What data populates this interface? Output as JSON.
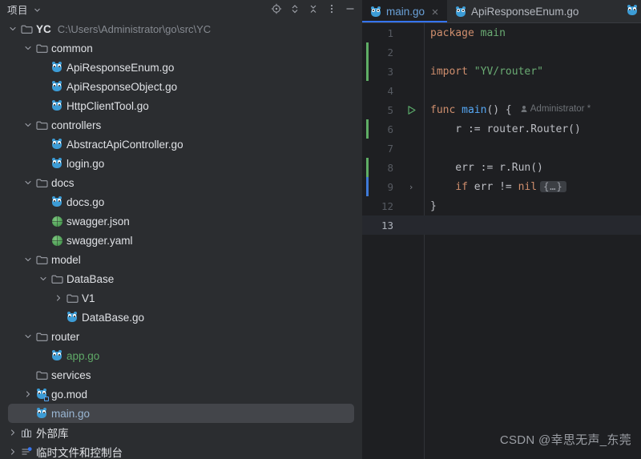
{
  "window": {
    "theme_bg": "#1E1F22",
    "sidebar_bg": "#2B2D30",
    "accent": "#3574F0"
  },
  "sidebar": {
    "title": "项目",
    "title_chevron_icon": "chevron-down-icon",
    "tools": [
      {
        "name": "locate-file-icon",
        "tooltip": "Select Opened File"
      },
      {
        "name": "expand-all-icon",
        "tooltip": "Expand All"
      },
      {
        "name": "collapse-all-icon",
        "tooltip": "Collapse All"
      },
      {
        "name": "more-options-icon",
        "tooltip": "Options"
      },
      {
        "name": "hide-panel-icon",
        "tooltip": "Hide"
      }
    ],
    "tree": [
      {
        "label": "YC",
        "sublabel": "C:\\Users\\Administrator\\go\\src\\YC",
        "indent": 0,
        "twisty": "expanded",
        "icon": "folder-icon",
        "bold": true,
        "state": "normal"
      },
      {
        "label": "common",
        "sublabel": "",
        "indent": 1,
        "twisty": "expanded",
        "icon": "folder-icon",
        "bold": false,
        "state": "normal"
      },
      {
        "label": "ApiResponseEnum.go",
        "sublabel": "",
        "indent": 2,
        "twisty": "none",
        "icon": "go-file-icon",
        "bold": false,
        "state": "normal"
      },
      {
        "label": "ApiResponseObject.go",
        "sublabel": "",
        "indent": 2,
        "twisty": "none",
        "icon": "go-file-icon",
        "bold": false,
        "state": "normal"
      },
      {
        "label": "HttpClientTool.go",
        "sublabel": "",
        "indent": 2,
        "twisty": "none",
        "icon": "go-file-icon",
        "bold": false,
        "state": "normal"
      },
      {
        "label": "controllers",
        "sublabel": "",
        "indent": 1,
        "twisty": "expanded",
        "icon": "folder-icon",
        "bold": false,
        "state": "normal"
      },
      {
        "label": "AbstractApiController.go",
        "sublabel": "",
        "indent": 2,
        "twisty": "none",
        "icon": "go-file-icon",
        "bold": false,
        "state": "normal"
      },
      {
        "label": "login.go",
        "sublabel": "",
        "indent": 2,
        "twisty": "none",
        "icon": "go-file-icon",
        "bold": false,
        "state": "normal"
      },
      {
        "label": "docs",
        "sublabel": "",
        "indent": 1,
        "twisty": "expanded",
        "icon": "folder-icon",
        "bold": false,
        "state": "normal"
      },
      {
        "label": "docs.go",
        "sublabel": "",
        "indent": 2,
        "twisty": "none",
        "icon": "go-file-icon",
        "bold": false,
        "state": "normal"
      },
      {
        "label": "swagger.json",
        "sublabel": "",
        "indent": 2,
        "twisty": "none",
        "icon": "json-file-icon",
        "bold": false,
        "state": "normal"
      },
      {
        "label": "swagger.yaml",
        "sublabel": "",
        "indent": 2,
        "twisty": "none",
        "icon": "yaml-file-icon",
        "bold": false,
        "state": "normal"
      },
      {
        "label": "model",
        "sublabel": "",
        "indent": 1,
        "twisty": "expanded",
        "icon": "folder-icon",
        "bold": false,
        "state": "normal"
      },
      {
        "label": "DataBase",
        "sublabel": "",
        "indent": 2,
        "twisty": "expanded",
        "icon": "folder-icon",
        "bold": false,
        "state": "normal"
      },
      {
        "label": "V1",
        "sublabel": "",
        "indent": 3,
        "twisty": "collapsed",
        "icon": "folder-icon",
        "bold": false,
        "state": "normal"
      },
      {
        "label": "DataBase.go",
        "sublabel": "",
        "indent": 3,
        "twisty": "none",
        "icon": "go-file-icon",
        "bold": false,
        "state": "normal"
      },
      {
        "label": "router",
        "sublabel": "",
        "indent": 1,
        "twisty": "expanded",
        "icon": "folder-icon",
        "bold": false,
        "state": "normal"
      },
      {
        "label": "app.go",
        "sublabel": "",
        "indent": 2,
        "twisty": "none",
        "icon": "go-file-icon",
        "bold": false,
        "state": "vcs-added"
      },
      {
        "label": "services",
        "sublabel": "",
        "indent": 1,
        "twisty": "none",
        "icon": "folder-icon",
        "bold": false,
        "state": "normal"
      },
      {
        "label": "go.mod",
        "sublabel": "",
        "indent": 1,
        "twisty": "collapsed",
        "icon": "go-module-icon",
        "bold": false,
        "state": "normal"
      },
      {
        "label": "main.go",
        "sublabel": "",
        "indent": 1,
        "twisty": "none",
        "icon": "go-file-icon",
        "bold": false,
        "state": "selected"
      },
      {
        "label": "外部库",
        "sublabel": "",
        "indent": 0,
        "twisty": "collapsed",
        "icon": "external-libraries-icon",
        "bold": false,
        "state": "normal"
      },
      {
        "label": "临时文件和控制台",
        "sublabel": "",
        "indent": 0,
        "twisty": "collapsed",
        "icon": "scratches-icon",
        "bold": false,
        "state": "normal"
      }
    ]
  },
  "editor": {
    "tabs": [
      {
        "label": "main.go",
        "icon": "go-file-icon",
        "active": true,
        "closable": true
      },
      {
        "label": "ApiResponseEnum.go",
        "icon": "go-file-icon",
        "active": false,
        "closable": false
      }
    ],
    "overflow_tab_icon": "go-file-icon",
    "inlay_hint": "Administrator *",
    "inlay_icon": "author-icon",
    "run_gutter_icon": "run-arrow-icon",
    "fold_placeholder": "{…}",
    "lines": [
      {
        "num": "1",
        "vcs": "none",
        "run": false,
        "fold": false,
        "current": false,
        "tokens": [
          {
            "t": "package",
            "c": "kw"
          },
          {
            "t": " ",
            "c": "plain"
          },
          {
            "t": "main",
            "c": "pkg"
          }
        ]
      },
      {
        "num": "2",
        "vcs": "added",
        "run": false,
        "fold": false,
        "current": false,
        "tokens": []
      },
      {
        "num": "3",
        "vcs": "added",
        "run": false,
        "fold": false,
        "current": false,
        "tokens": [
          {
            "t": "import",
            "c": "kw"
          },
          {
            "t": " ",
            "c": "plain"
          },
          {
            "t": "\"YV/router\"",
            "c": "str"
          }
        ]
      },
      {
        "num": "4",
        "vcs": "none",
        "run": false,
        "fold": false,
        "current": false,
        "tokens": []
      },
      {
        "num": "5",
        "vcs": "none",
        "run": true,
        "fold": false,
        "current": false,
        "tokens": [
          {
            "t": "func",
            "c": "kw"
          },
          {
            "t": " ",
            "c": "plain"
          },
          {
            "t": "main",
            "c": "fn"
          },
          {
            "t": "() {",
            "c": "plain"
          }
        ]
      },
      {
        "num": "6",
        "vcs": "added",
        "run": false,
        "fold": false,
        "current": false,
        "tokens": [
          {
            "t": "    r := router.Router()",
            "c": "plain"
          }
        ]
      },
      {
        "num": "7",
        "vcs": "none",
        "run": false,
        "fold": false,
        "current": false,
        "tokens": []
      },
      {
        "num": "8",
        "vcs": "added",
        "run": false,
        "fold": false,
        "current": false,
        "tokens": [
          {
            "t": "    err := r.Run()",
            "c": "plain"
          }
        ]
      },
      {
        "num": "9",
        "vcs": "changed",
        "run": false,
        "fold": true,
        "current": false,
        "tokens": [
          {
            "t": "    ",
            "c": "plain"
          },
          {
            "t": "if",
            "c": "kw"
          },
          {
            "t": " err != ",
            "c": "plain"
          },
          {
            "t": "nil",
            "c": "kw"
          }
        ]
      },
      {
        "num": "12",
        "vcs": "none",
        "run": false,
        "fold": false,
        "current": false,
        "tokens": [
          {
            "t": "}",
            "c": "plain"
          }
        ]
      },
      {
        "num": "13",
        "vcs": "none",
        "run": false,
        "fold": false,
        "current": true,
        "tokens": []
      }
    ]
  },
  "watermark": "CSDN @幸思无声_东莞"
}
